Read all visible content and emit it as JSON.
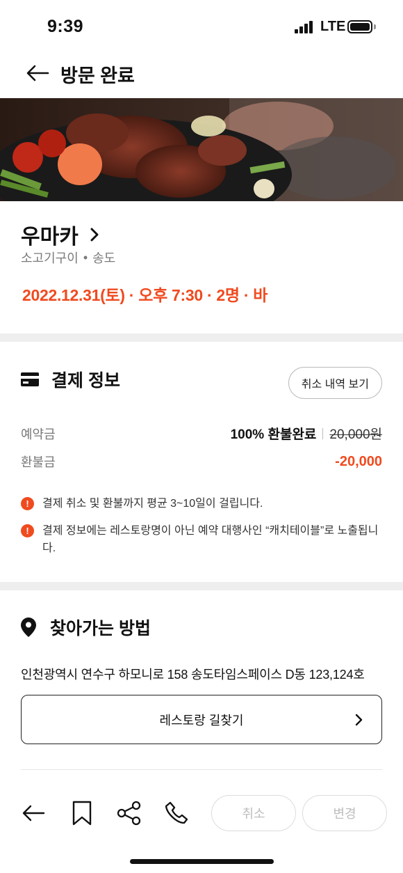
{
  "status_bar": {
    "time": "9:39",
    "network": "LTE"
  },
  "header": {
    "title": "방문 완료"
  },
  "restaurant": {
    "name": "우마카",
    "category": "소고기구이",
    "location": "송도",
    "reservation": "2022.12.31(토) · 오후 7:30 · 2명 · 바"
  },
  "payment": {
    "title": "결제 정보",
    "history_button": "취소 내역 보기",
    "deposit_label": "예약금",
    "deposit_status": "100% 환불완료",
    "deposit_original": "20,000원",
    "refund_label": "환불금",
    "refund_value": "-20,000",
    "notices": [
      "결제 취소 및 환불까지 평균 3~10일이 걸립니다.",
      "결제 정보에는 레스토랑명이 아닌 예약 대행사인 “캐치테이블”로 노출됩니다."
    ]
  },
  "directions": {
    "title": "찾아가는 방법",
    "address": "인천광역시 연수구 하모니로 158 송도타임스페이스 D동 123,124호",
    "route_button": "레스토랑 길찾기"
  },
  "bottom_bar": {
    "cancel_label": "취소",
    "change_label": "변경"
  },
  "colors": {
    "accent": "#f04a1f",
    "divider": "#eeeeee",
    "disabled": "#bdbdbd"
  },
  "icons": [
    "back-arrow-icon",
    "chevron-right-icon",
    "card-icon",
    "info-icon",
    "location-pin-icon",
    "bookmark-icon",
    "share-icon",
    "phone-icon"
  ]
}
